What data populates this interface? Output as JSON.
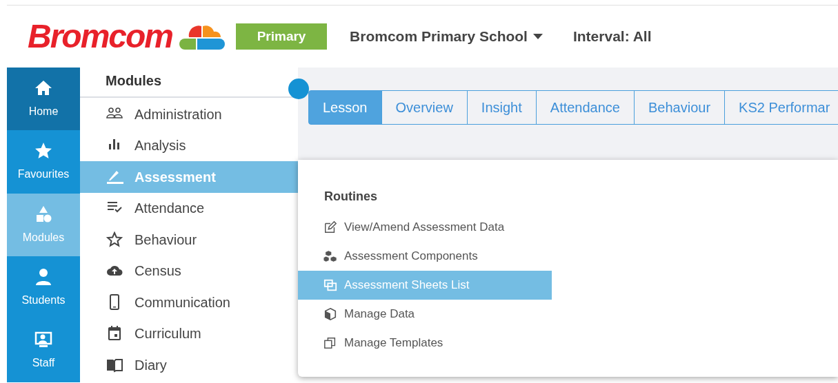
{
  "header": {
    "logo": "Bromcom",
    "phase": "Primary",
    "school": "Bromcom Primary School",
    "interval": "Interval: All"
  },
  "nav": [
    {
      "label": "Home",
      "kind": "home",
      "selected": false
    },
    {
      "label": "Favourites",
      "kind": "star",
      "selected": false
    },
    {
      "label": "Modules",
      "kind": "shapes",
      "selected": true
    },
    {
      "label": "Students",
      "kind": "person",
      "selected": false
    },
    {
      "label": "Staff",
      "kind": "monitor",
      "selected": false
    }
  ],
  "modules": {
    "title": "Modules",
    "items": [
      {
        "label": "Administration",
        "kind": "people",
        "selected": false
      },
      {
        "label": "Analysis",
        "kind": "bars",
        "selected": false
      },
      {
        "label": "Assessment",
        "kind": "pencil",
        "selected": true
      },
      {
        "label": "Attendance",
        "kind": "checklist",
        "selected": false
      },
      {
        "label": "Behaviour",
        "kind": "star",
        "selected": false
      },
      {
        "label": "Census",
        "kind": "cloud",
        "selected": false
      },
      {
        "label": "Communication",
        "kind": "phone",
        "selected": false
      },
      {
        "label": "Curriculum",
        "kind": "calendar",
        "selected": false
      },
      {
        "label": "Diary",
        "kind": "book",
        "selected": false
      }
    ]
  },
  "tabs": [
    {
      "label": "Lesson",
      "selected": true
    },
    {
      "label": "Overview",
      "selected": false
    },
    {
      "label": "Insight",
      "selected": false
    },
    {
      "label": "Attendance",
      "selected": false
    },
    {
      "label": "Behaviour",
      "selected": false
    },
    {
      "label": "KS2 Performar",
      "selected": false
    }
  ],
  "routines": {
    "title": "Routines",
    "items": [
      {
        "label": "View/Amend Assessment Data",
        "kind": "edit",
        "selected": false
      },
      {
        "label": "Assessment Components",
        "kind": "cubes",
        "selected": false
      },
      {
        "label": "Assessment Sheets List",
        "kind": "copy",
        "selected": true
      },
      {
        "label": "Manage Data",
        "kind": "cube",
        "selected": false
      },
      {
        "label": "Manage Templates",
        "kind": "clone",
        "selected": false
      }
    ]
  }
}
